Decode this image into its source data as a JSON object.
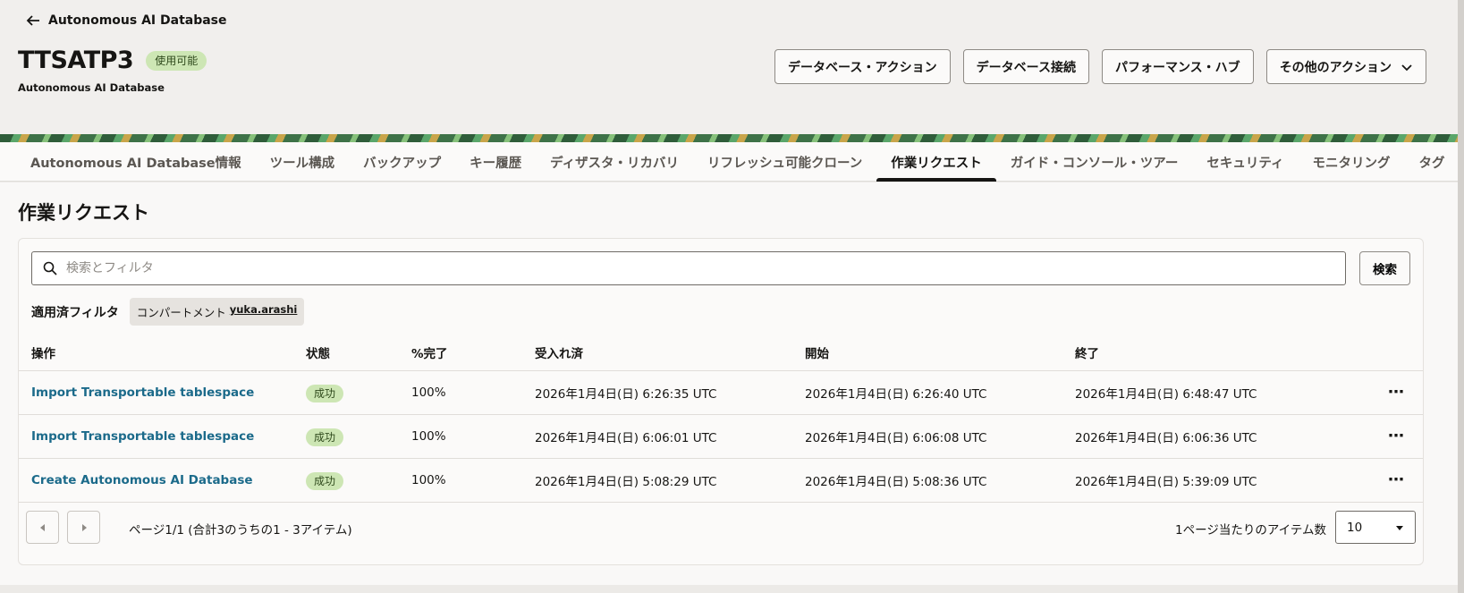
{
  "header": {
    "back_label": "Autonomous AI Database",
    "title": "TTSATP3",
    "status_badge": "使用可能",
    "subtitle": "Autonomous AI Database",
    "actions": {
      "db_actions": "データベース・アクション",
      "db_connection": "データベース接続",
      "performance_hub": "パフォーマンス・ハブ",
      "more_actions": "その他のアクション"
    }
  },
  "tabs": [
    {
      "label": "Autonomous AI Database情報"
    },
    {
      "label": "ツール構成"
    },
    {
      "label": "バックアップ"
    },
    {
      "label": "キー履歴"
    },
    {
      "label": "ディザスタ・リカバリ"
    },
    {
      "label": "リフレッシュ可能クローン"
    },
    {
      "label": "作業リクエスト"
    },
    {
      "label": "ガイド・コンソール・ツアー"
    },
    {
      "label": "セキュリティ"
    },
    {
      "label": "モニタリング"
    },
    {
      "label": "タグ"
    }
  ],
  "section": {
    "title": "作業リクエスト",
    "search": {
      "placeholder": "検索とフィルタ",
      "button": "検索"
    },
    "filters": {
      "label": "適用済フィルタ",
      "chip_key": "コンパートメント",
      "chip_value": "yuka.arashi"
    }
  },
  "table": {
    "headers": {
      "op": "操作",
      "state": "状態",
      "pct": "%完了",
      "accepted": "受入れ済",
      "started": "開始",
      "finished": "終了"
    },
    "rows": [
      {
        "op": "Import Transportable tablespace",
        "state": "成功",
        "pct": "100%",
        "accepted": "2026年1月4日(日) 6:26:35 UTC",
        "started": "2026年1月4日(日) 6:26:40 UTC",
        "finished": "2026年1月4日(日) 6:48:47 UTC"
      },
      {
        "op": "Import Transportable tablespace",
        "state": "成功",
        "pct": "100%",
        "accepted": "2026年1月4日(日) 6:06:01 UTC",
        "started": "2026年1月4日(日) 6:06:08 UTC",
        "finished": "2026年1月4日(日) 6:06:36 UTC"
      },
      {
        "op": "Create Autonomous AI Database",
        "state": "成功",
        "pct": "100%",
        "accepted": "2026年1月4日(日) 5:08:29 UTC",
        "started": "2026年1月4日(日) 5:08:36 UTC",
        "finished": "2026年1月4日(日) 5:39:09 UTC"
      }
    ]
  },
  "pager": {
    "info": "ページ1/1 (合計3のうちの1 - 3アイテム)",
    "per_page_label": "1ページ当たりのアイテム数",
    "per_page_value": "10"
  }
}
